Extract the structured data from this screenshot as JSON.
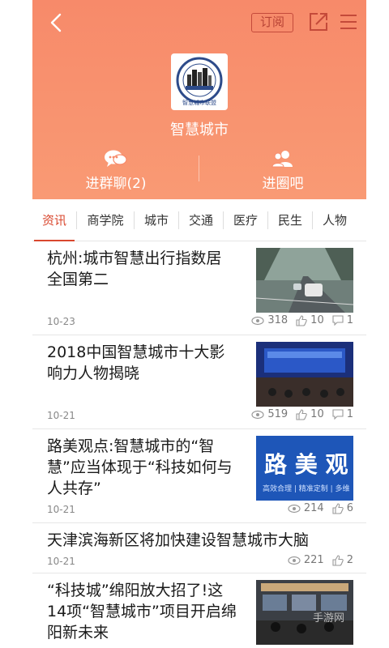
{
  "header": {
    "subscribe_label": "订阅",
    "logo_text": "智慧城市联盟",
    "group_title": "智慧城市",
    "join_chat_label": "进群聊(2)",
    "join_circle_label": "进圈吧"
  },
  "tabs": [
    {
      "label": "资讯",
      "active": true
    },
    {
      "label": "商学院"
    },
    {
      "label": "城市"
    },
    {
      "label": "交通"
    },
    {
      "label": "医疗"
    },
    {
      "label": "民生"
    },
    {
      "label": "人物"
    }
  ],
  "articles": [
    {
      "title_lines": [
        "杭州:城市智慧出行指数居",
        "全国第二"
      ],
      "date": "10-23",
      "views": "318",
      "likes": "10",
      "comments": "1",
      "thumb": "road-cars-photo"
    },
    {
      "title_lines": [
        "2018中国智慧城市十大影",
        "响力人物揭晓"
      ],
      "date": "10-21",
      "views": "519",
      "likes": "10",
      "comments": "1",
      "thumb": "conference-stage-photo"
    },
    {
      "title_lines": [
        "路美观点:智慧城市的“智",
        "慧”应当体现于“科技如何与",
        "人共存”"
      ],
      "date": "10-21",
      "views": "214",
      "likes": "6",
      "comments": "",
      "thumb": "blue-banner-image",
      "thumb_text": "路 美 观",
      "thumb_subtext": "高效合理 | 精准定制 | 多维"
    },
    {
      "title_lines": [
        "天津滨海新区将加快建设智慧城市大脑"
      ],
      "date": "10-21",
      "views": "221",
      "likes": "2",
      "comments": "",
      "thumb": ""
    },
    {
      "title_lines": [
        "“科技城”绵阳放大招了!这",
        "14项“智慧城市”项目开启绵",
        "阳新未来"
      ],
      "date": "",
      "views": "",
      "likes": "",
      "comments": "",
      "thumb": "control-room-photo"
    }
  ],
  "watermark": "手游网"
}
